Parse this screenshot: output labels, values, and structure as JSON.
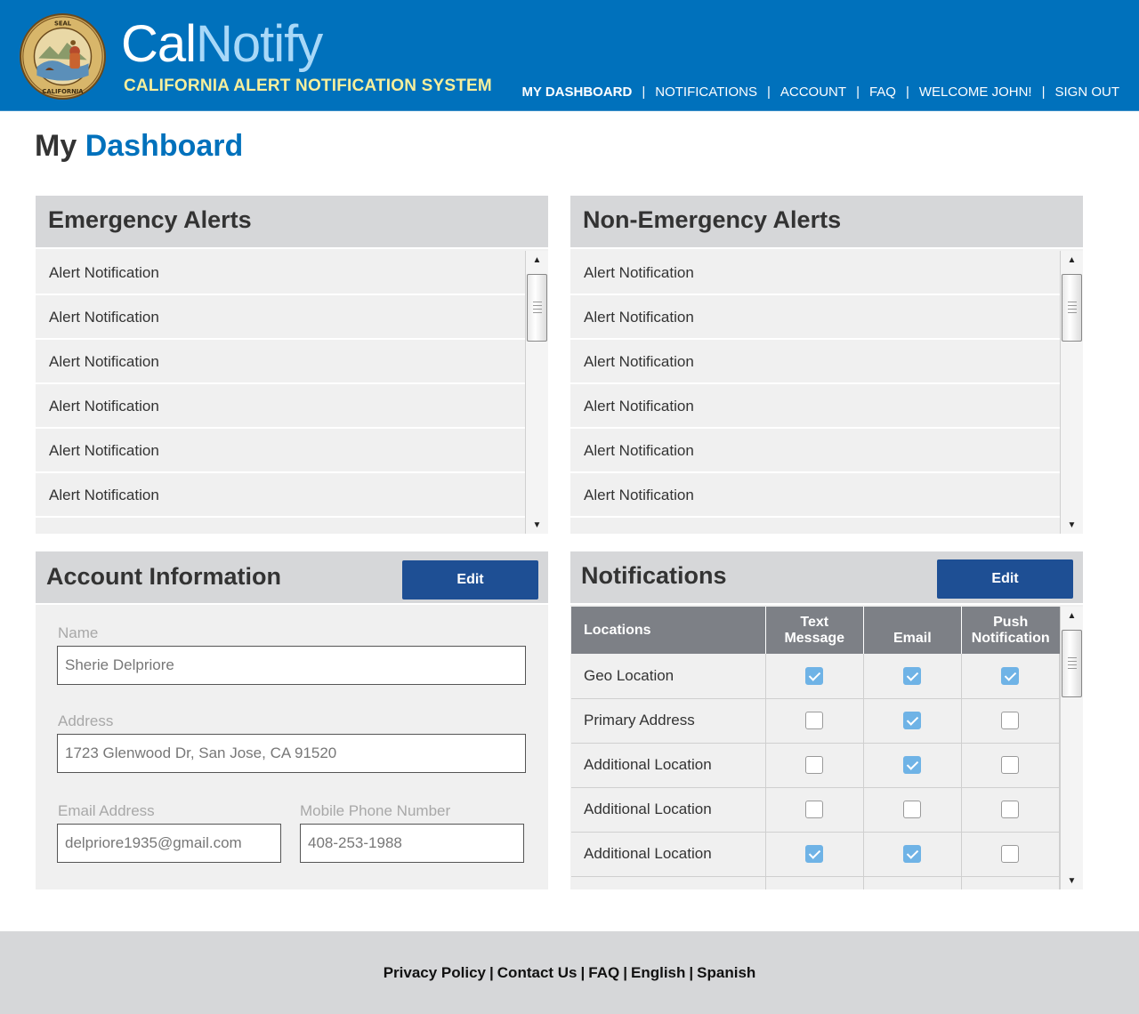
{
  "header": {
    "brand_cal": "Cal",
    "brand_notify": "Notify",
    "subtitle": "CALIFORNIA ALERT NOTIFICATION SYSTEM",
    "seal_text": "THE GREAT SEAL OF THE STATE OF CALIFORNIA",
    "seal_motto": "EUREKA",
    "nav": [
      {
        "label": "MY DASHBOARD",
        "active": true
      },
      {
        "label": "NOTIFICATIONS",
        "active": false
      },
      {
        "label": "ACCOUNT",
        "active": false
      },
      {
        "label": "FAQ",
        "active": false
      },
      {
        "label": "WELCOME JOHN!",
        "active": false
      },
      {
        "label": "SIGN OUT",
        "active": false
      }
    ],
    "colors": {
      "bar": "#0071bc",
      "notify": "#a8d8f8",
      "subtitle": "#f7ef9c"
    }
  },
  "page_title": {
    "part1": "My",
    "part2": "Dashboard"
  },
  "emergency": {
    "title": "Emergency Alerts",
    "items": [
      "Alert Notification",
      "Alert Notification",
      "Alert Notification",
      "Alert Notification",
      "Alert Notification",
      "Alert Notification"
    ]
  },
  "non_emergency": {
    "title": "Non-Emergency Alerts",
    "items": [
      "Alert Notification",
      "Alert Notification",
      "Alert Notification",
      "Alert Notification",
      "Alert Notification",
      "Alert Notification"
    ]
  },
  "account": {
    "title": "Account Information",
    "edit_label": "Edit",
    "name_label": "Name",
    "name_value": "Sherie Delpriore",
    "address_label": "Address",
    "address_value": "1723 Glenwood Dr, San Jose, CA 91520",
    "email_label": "Email Address",
    "email_value": "delpriore1935@gmail.com",
    "phone_label": "Mobile Phone Number",
    "phone_value": "408-253-1988"
  },
  "notifications": {
    "title": "Notifications",
    "edit_label": "Edit",
    "columns": {
      "locations": "Locations",
      "text_1": "Text",
      "text_2": "Message",
      "email": "Email",
      "push_1": "Push",
      "push_2": "Notification"
    },
    "rows": [
      {
        "location": "Geo Location",
        "text": true,
        "email": true,
        "push": true
      },
      {
        "location": "Primary Address",
        "text": false,
        "email": true,
        "push": false
      },
      {
        "location": "Additional Location",
        "text": false,
        "email": true,
        "push": false
      },
      {
        "location": "Additional Location",
        "text": false,
        "email": false,
        "push": false
      },
      {
        "location": "Additional Location",
        "text": true,
        "email": true,
        "push": false
      }
    ],
    "colors": {
      "checked": "#6fb3e6",
      "header": "#7d8086"
    }
  },
  "footer": {
    "links": [
      "Privacy Policy",
      "Contact Us",
      "FAQ",
      "English",
      "Spanish"
    ]
  },
  "icons": {
    "seal": "california-state-seal",
    "scroll_up": "triangle-up",
    "scroll_down": "triangle-down",
    "checkbox": "checkmark"
  }
}
